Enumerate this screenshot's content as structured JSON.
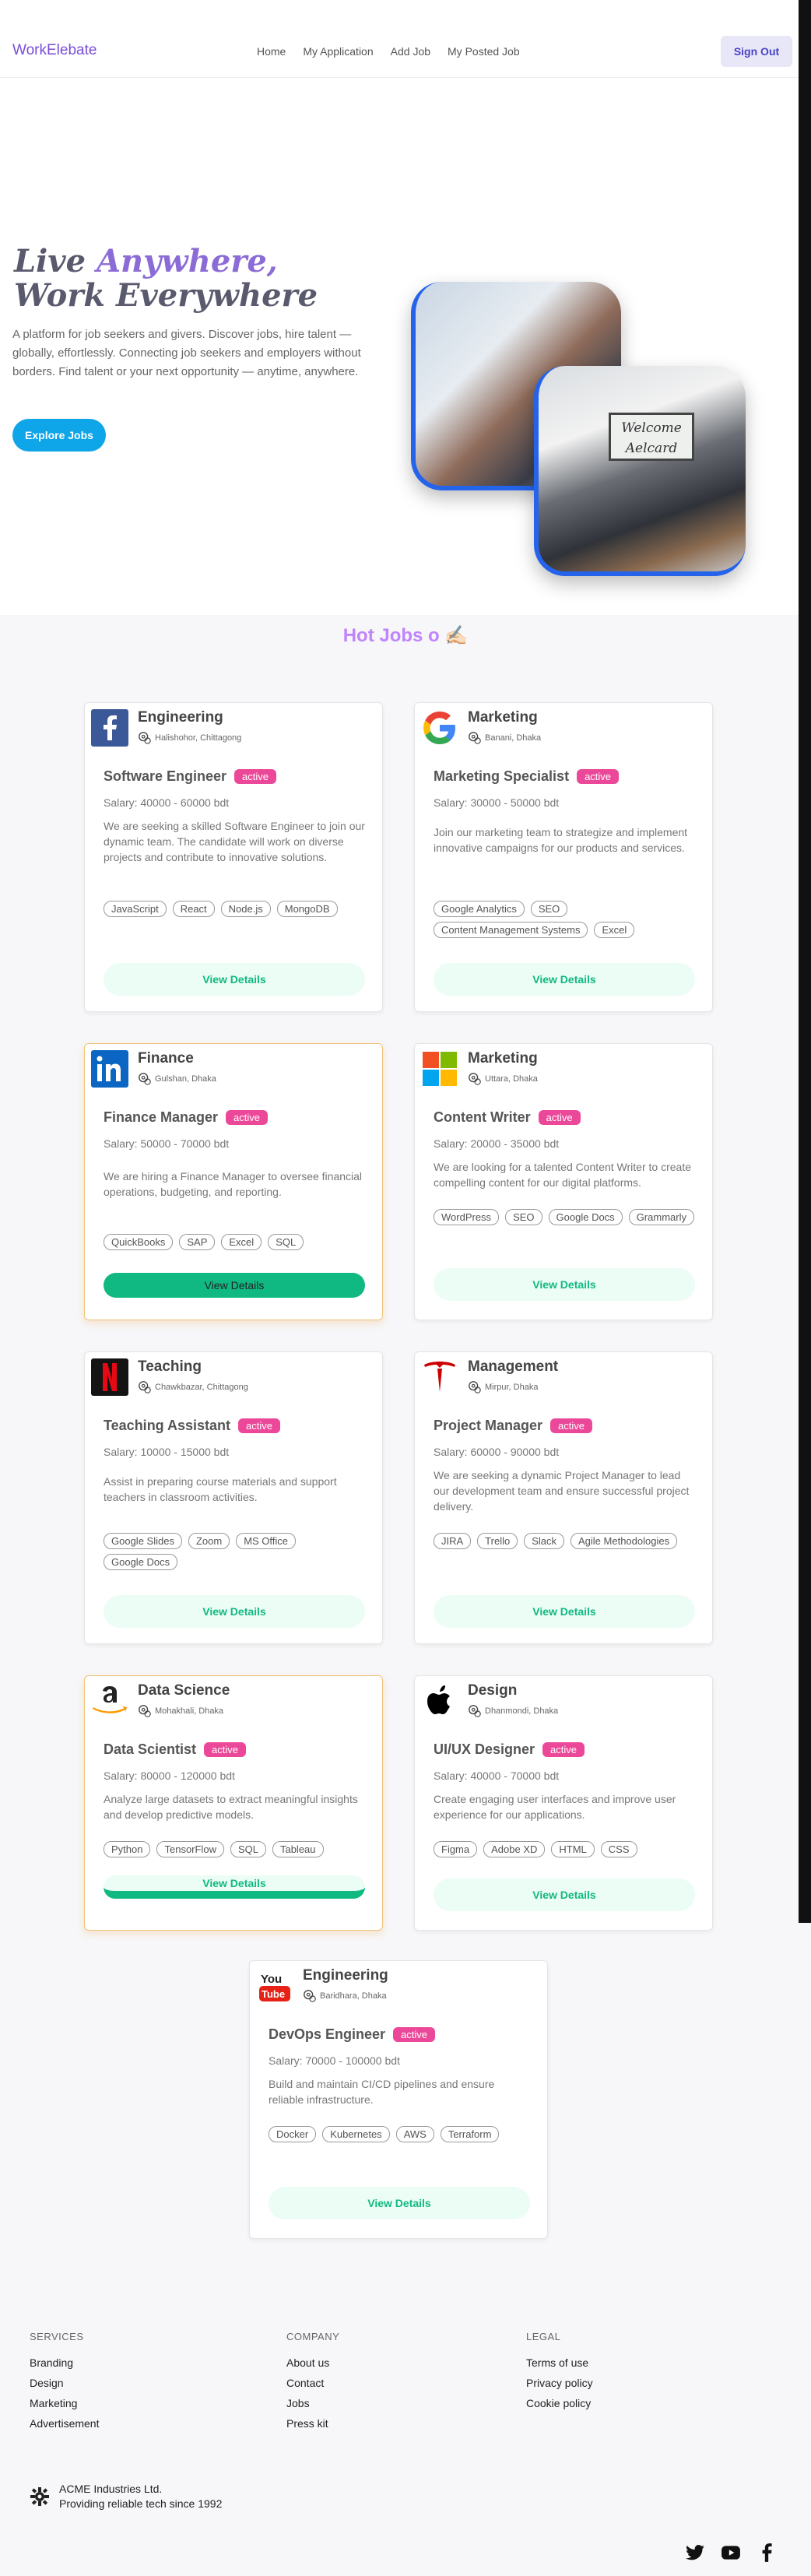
{
  "nav": {
    "brand": "WorkElebate",
    "links": [
      "Home",
      "My Application",
      "Add Job",
      "My Posted Job"
    ],
    "sign_out": "Sign Out"
  },
  "hero": {
    "title_part1": "Live ",
    "title_accent": "Anywhere,",
    "title_part2": " Work Everywhere",
    "description": "A platform for job seekers and givers. Discover jobs, hire talent — globally, effortlessly. Connecting job seekers and employers without borders. Find talent or your next opportunity — anytime, anywhere.",
    "button": "Explore Jobs",
    "image_sign": "Welcome Aelcard"
  },
  "section_title": "Hot Jobs o ✍🏻",
  "jobs": [
    {
      "logo": "facebook-logo",
      "category": "Engineering",
      "location": "Halishohor, Chittagong",
      "title": "Software Engineer",
      "status": "active",
      "salary": "Salary: 40000 - 60000 bdt",
      "description": "We are seeking a skilled Software Engineer to join our dynamic team. The candidate will work on diverse projects and contribute to innovative solutions.",
      "skills": [
        "JavaScript",
        "React",
        "Node.js",
        "MongoDB"
      ],
      "button": "View Details"
    },
    {
      "logo": "google-logo",
      "category": "Marketing",
      "location": "Banani, Dhaka",
      "title": "Marketing Specialist",
      "status": "active",
      "salary": "Salary: 30000 - 50000 bdt",
      "description": "Join our marketing team to strategize and implement innovative campaigns for our products and services.",
      "skills": [
        "Google Analytics",
        "SEO",
        "Content Management Systems",
        "Excel"
      ],
      "button": "View Details"
    },
    {
      "logo": "linkedin-logo",
      "category": "Finance",
      "location": "Gulshan, Dhaka",
      "title": "Finance Manager",
      "status": "active",
      "salary": "Salary: 50000 - 70000 bdt",
      "description": "We are hiring a Finance Manager to oversee financial operations, budgeting, and reporting.",
      "skills": [
        "QuickBooks",
        "SAP",
        "Excel",
        "SQL"
      ],
      "button": "View Details"
    },
    {
      "logo": "microsoft-logo",
      "category": "Marketing",
      "location": "Uttara, Dhaka",
      "title": "Content Writer",
      "status": "active",
      "salary": "Salary: 20000 - 35000 bdt",
      "description": "We are looking for a talented Content Writer to create compelling content for our digital platforms.",
      "skills": [
        "WordPress",
        "SEO",
        "Google Docs",
        "Grammarly"
      ],
      "button": "View Details"
    },
    {
      "logo": "netflix-logo",
      "category": "Teaching",
      "location": "Chawkbazar, Chittagong",
      "title": "Teaching Assistant",
      "status": "active",
      "salary": "Salary: 10000 - 15000 bdt",
      "description": "Assist in preparing course materials and support teachers in classroom activities.",
      "skills": [
        "Google Slides",
        "Zoom",
        "MS Office",
        "Google Docs"
      ],
      "button": "View Details"
    },
    {
      "logo": "tesla-logo",
      "category": "Management",
      "location": "Mirpur, Dhaka",
      "title": "Project Manager",
      "status": "active",
      "salary": "Salary: 60000 - 90000 bdt",
      "description": "We are seeking a dynamic Project Manager to lead our development team and ensure successful project delivery.",
      "skills": [
        "JIRA",
        "Trello",
        "Slack",
        "Agile Methodologies"
      ],
      "button": "View Details"
    },
    {
      "logo": "amazon-logo",
      "category": "Data Science",
      "location": "Mohakhali, Dhaka",
      "title": "Data Scientist",
      "status": "active",
      "salary": "Salary: 80000 - 120000 bdt",
      "description": "Analyze large datasets to extract meaningful insights and develop predictive models.",
      "skills": [
        "Python",
        "TensorFlow",
        "SQL",
        "Tableau"
      ],
      "button": "View Details"
    },
    {
      "logo": "apple-logo",
      "category": "Design",
      "location": "Dhanmondi, Dhaka",
      "title": "UI/UX Designer",
      "status": "active",
      "salary": "Salary: 40000 - 70000 bdt",
      "description": "Create engaging user interfaces and improve user experience for our applications.",
      "skills": [
        "Figma",
        "Adobe XD",
        "HTML",
        "CSS"
      ],
      "button": "View Details"
    },
    {
      "logo": "youtube-logo",
      "category": "Engineering",
      "location": "Baridhara, Dhaka",
      "title": "DevOps Engineer",
      "status": "active",
      "salary": "Salary: 70000 - 100000 bdt",
      "description": "Build and maintain CI/CD pipelines and ensure reliable infrastructure.",
      "skills": [
        "Docker",
        "Kubernetes",
        "AWS",
        "Terraform"
      ],
      "button": "View Details"
    }
  ],
  "footer": {
    "services": {
      "heading": "SERVICES",
      "items": [
        "Branding",
        "Design",
        "Marketing",
        "Advertisement"
      ]
    },
    "company": {
      "heading": "COMPANY",
      "items": [
        "About us",
        "Contact",
        "Jobs",
        "Press kit"
      ]
    },
    "legal": {
      "heading": "LEGAL",
      "items": [
        "Terms of use",
        "Privacy policy",
        "Cookie policy"
      ]
    },
    "company_name": "ACME Industries Ltd.",
    "tagline": "Providing reliable tech since 1992",
    "social": [
      "twitter-icon",
      "youtube-icon",
      "facebook-icon"
    ]
  },
  "colors": {
    "brand": "#7a4fd6",
    "badge": "#ec4899",
    "button_text": "#10b981",
    "explore": "#0ea5e9",
    "hot_title": "#c084fc"
  }
}
